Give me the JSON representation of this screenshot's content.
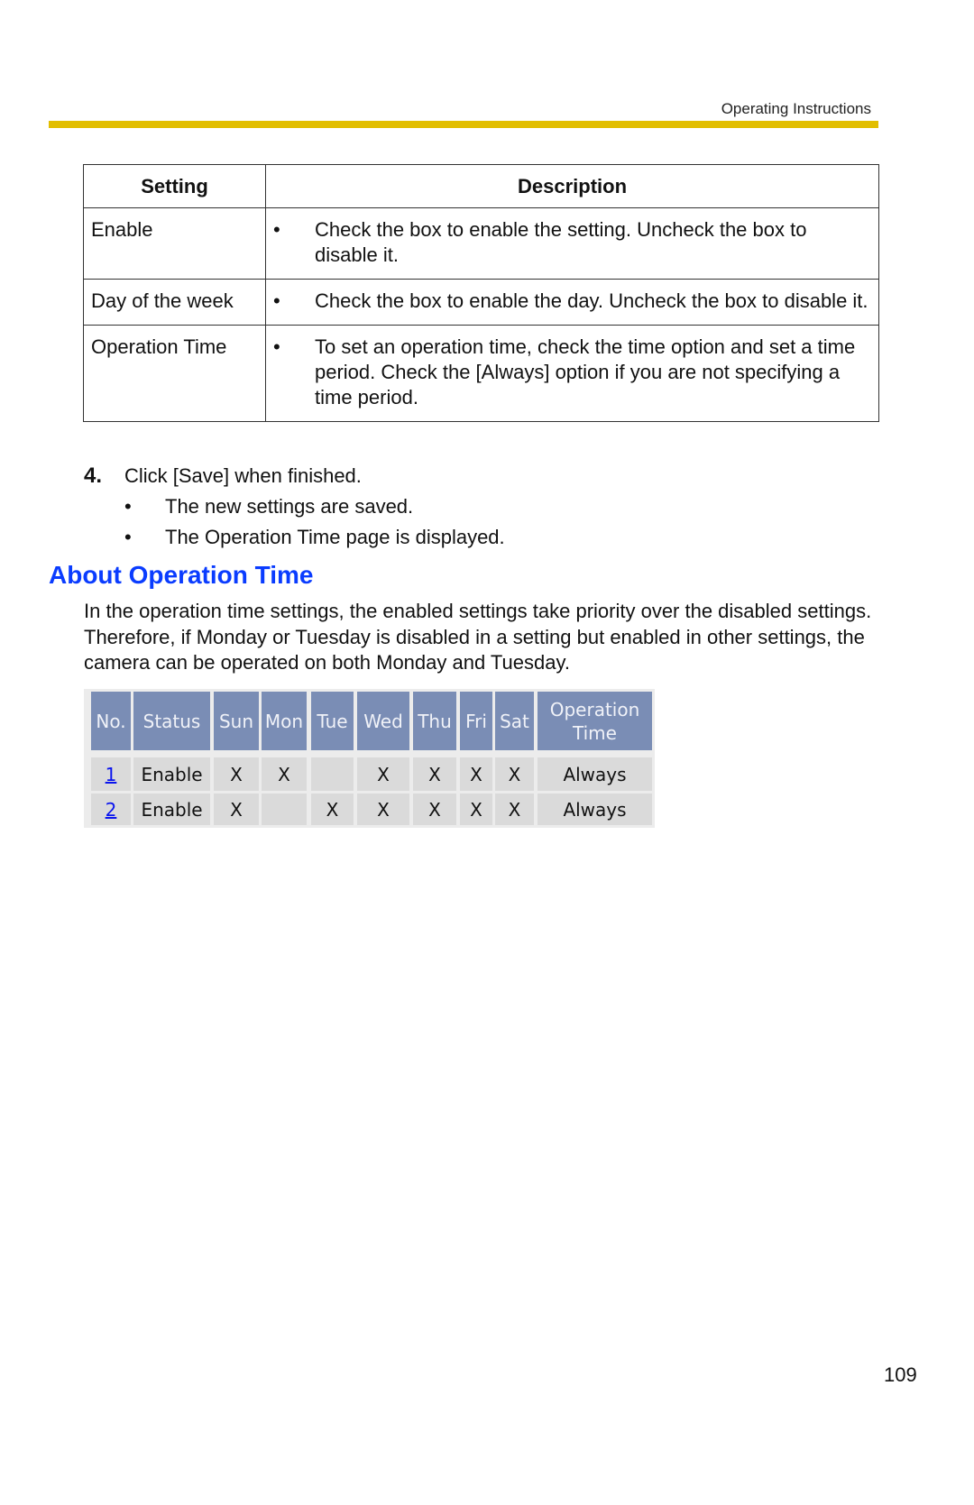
{
  "header": {
    "title": "Operating Instructions",
    "accent_color": "#e2be00"
  },
  "settings_table": {
    "columns": [
      "Setting",
      "Description"
    ],
    "rows": [
      {
        "setting": "Enable",
        "bullet": "•",
        "description": "Check the box to enable the setting. Uncheck the box to disable it."
      },
      {
        "setting": "Day of the week",
        "bullet": "•",
        "description": "Check the box to enable the day. Uncheck the box to disable it."
      },
      {
        "setting": "Operation Time",
        "bullet": "•",
        "description": "To set an operation time, check the time option and set a time period. Check the [Always] option if you are not specifying a time period."
      }
    ]
  },
  "step": {
    "number": "4.",
    "text": "Click [Save] when finished.",
    "bullets": [
      "The new settings are saved.",
      "The Operation Time page is displayed."
    ],
    "bullet_glyph": "•"
  },
  "section": {
    "title": "About Operation Time",
    "title_color": "#0a3cff",
    "paragraph": "In the operation time settings, the enabled settings take priority over the disabled settings. Therefore, if Monday or Tuesday is disabled in a setting but enabled in other settings, the camera can be operated on both Monday and Tuesday."
  },
  "operation_table": {
    "header_color": "#7a8db5",
    "cell_color": "#dadada",
    "columns": [
      "No.",
      "Status",
      "Sun",
      "Mon",
      "Tue",
      "Wed",
      "Thu",
      "Fri",
      "Sat",
      "Operation Time"
    ],
    "rows": [
      {
        "no": "1",
        "status": "Enable",
        "sun": "X",
        "mon": "X",
        "tue": "",
        "wed": "X",
        "thu": "X",
        "fri": "X",
        "sat": "X",
        "time": "Always"
      },
      {
        "no": "2",
        "status": "Enable",
        "sun": "X",
        "mon": "",
        "tue": "X",
        "wed": "X",
        "thu": "X",
        "fri": "X",
        "sat": "X",
        "time": "Always"
      }
    ]
  },
  "page_number": "109"
}
